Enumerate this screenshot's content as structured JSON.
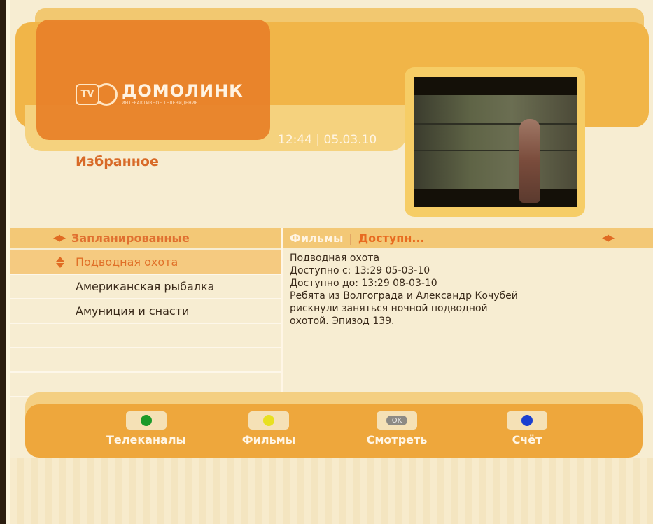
{
  "header": {
    "brand_badge": "TV",
    "brand_name": "ДОМОЛИНК",
    "brand_tagline": "ИНТЕРАКТИВНОЕ ТЕЛЕВИДЕНИЕ",
    "clock": "12:44 | 05.03.10",
    "section_title": "Избранное"
  },
  "category": {
    "label": "Запланированные",
    "arrows_icon": "left-right-arrows-icon"
  },
  "tabs": [
    {
      "label": "Фильмы"
    },
    {
      "label": "Доступн..."
    }
  ],
  "list": {
    "items": [
      {
        "label": "Подводная охота",
        "selected": true
      },
      {
        "label": "Американская рыбалка",
        "selected": false
      },
      {
        "label": "Амуниция и снасти",
        "selected": false
      },
      {
        "label": ""
      },
      {
        "label": ""
      },
      {
        "label": ""
      }
    ]
  },
  "details": {
    "title": "Подводная охота",
    "available_from": "Доступно с: 13:29 05-03-10",
    "available_to": "Доступно до: 13:29 08-03-10",
    "description_lines": [
      "Ребята из Волгограда и Александр Кочубей",
      "рискнули заняться ночной подводной",
      "охотой. Эпизод 139."
    ]
  },
  "footer": {
    "buttons": [
      {
        "label": "Телеканалы",
        "key": "green-key-icon",
        "color": "#1a9a2a"
      },
      {
        "label": "Фильмы",
        "key": "yellow-key-icon",
        "color": "#e8e020"
      },
      {
        "label": "Смотреть",
        "key": "ok-key-icon",
        "key_text": "OK"
      },
      {
        "label": "Счёт",
        "key": "blue-key-icon",
        "color": "#1a3fd0"
      }
    ]
  },
  "colors": {
    "accent": "#e07030",
    "band": "#f1b548",
    "background": "#f7edd2"
  }
}
